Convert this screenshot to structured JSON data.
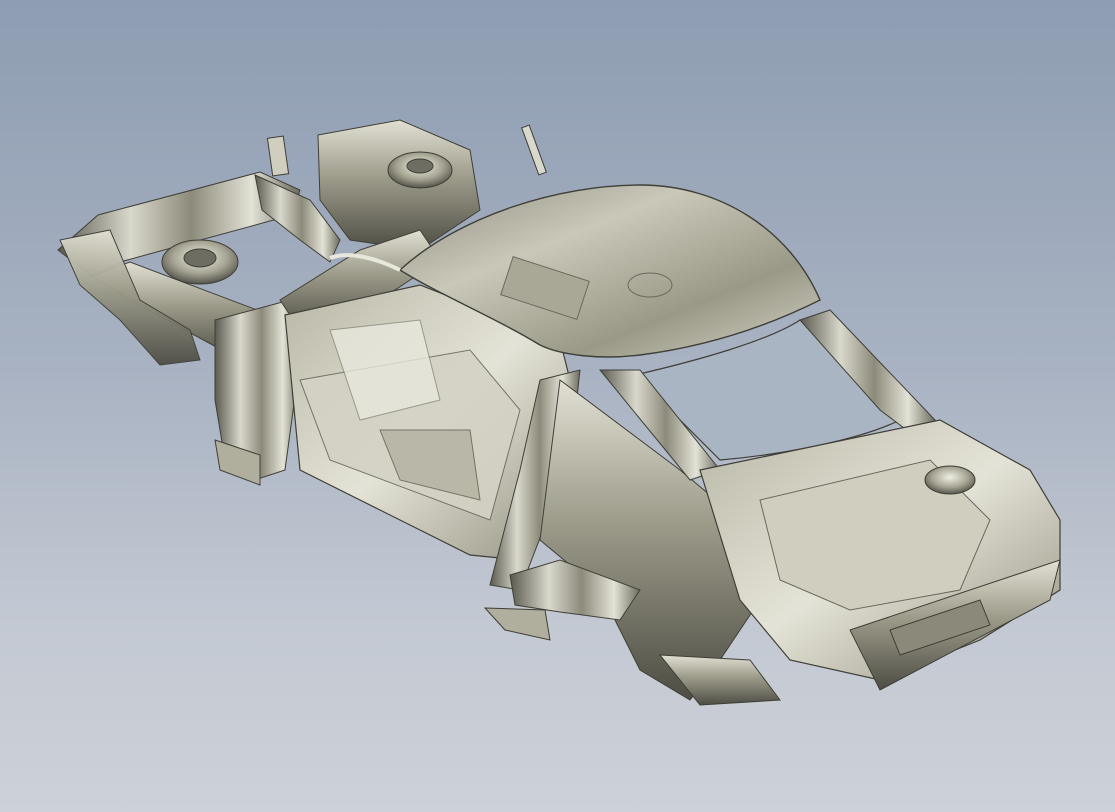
{
  "viewport": {
    "background_top": "#8e9db2",
    "background_bottom": "#cdd1d8"
  },
  "model": {
    "icon": "car-body-in-white-3d-model",
    "material_light": "#e7e7dc",
    "material_mid": "#a9a897",
    "material_dark": "#3f3f37"
  }
}
